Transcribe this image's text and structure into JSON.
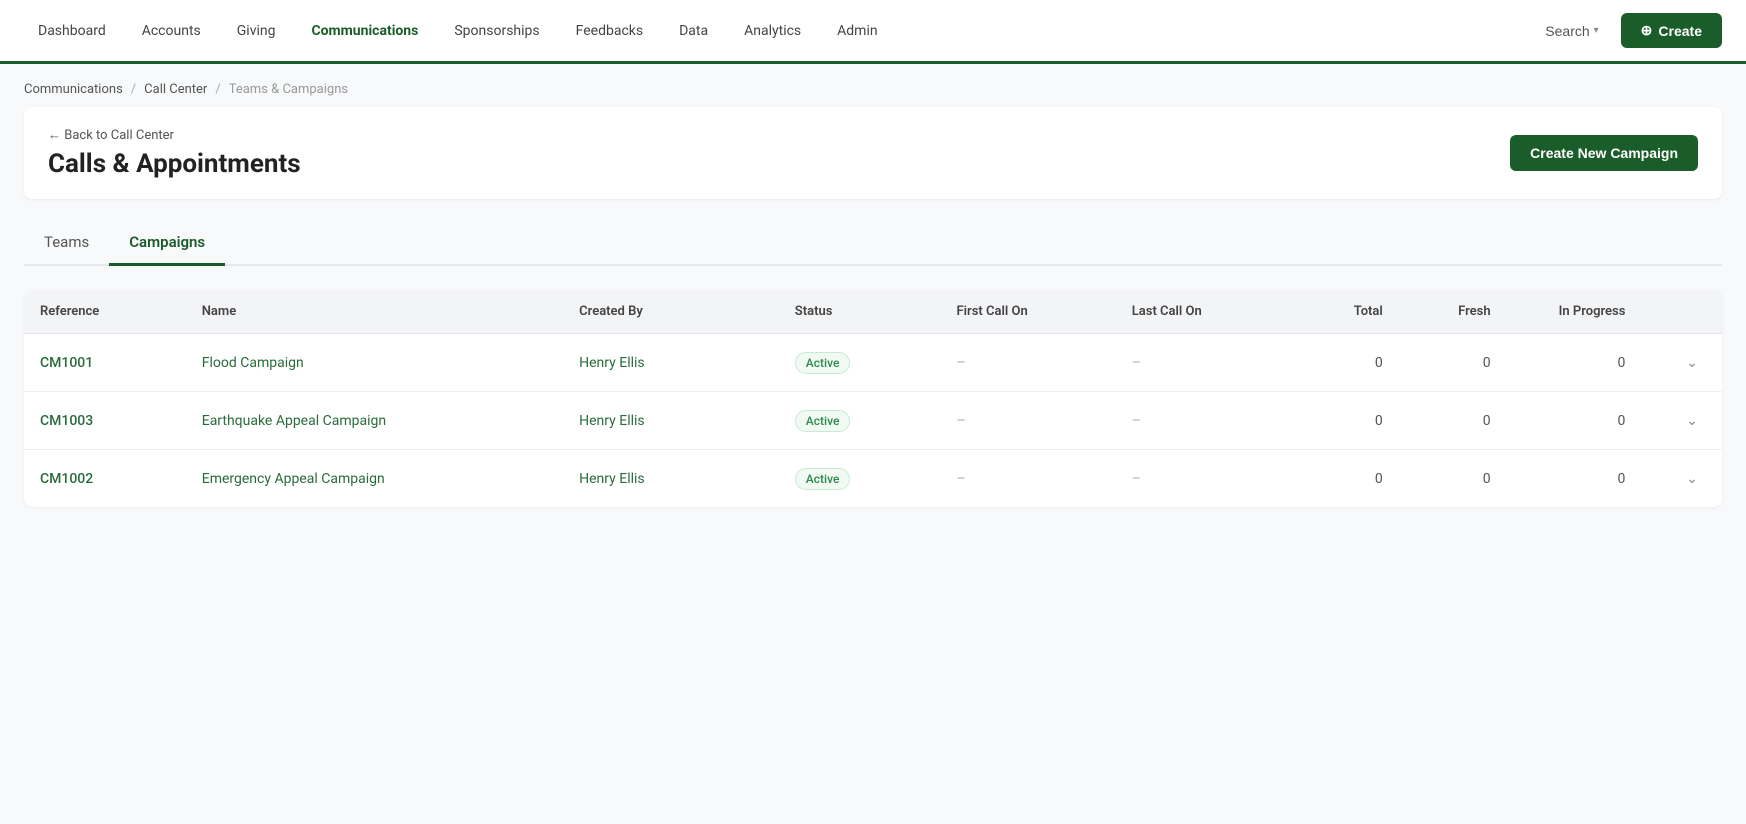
{
  "nav": {
    "items": [
      {
        "id": "dashboard",
        "label": "Dashboard",
        "active": false
      },
      {
        "id": "accounts",
        "label": "Accounts",
        "active": false
      },
      {
        "id": "giving",
        "label": "Giving",
        "active": false
      },
      {
        "id": "communications",
        "label": "Communications",
        "active": true
      },
      {
        "id": "sponsorships",
        "label": "Sponsorships",
        "active": false
      },
      {
        "id": "feedbacks",
        "label": "Feedbacks",
        "active": false
      },
      {
        "id": "data",
        "label": "Data",
        "active": false
      },
      {
        "id": "analytics",
        "label": "Analytics",
        "active": false
      },
      {
        "id": "admin",
        "label": "Admin",
        "active": false
      }
    ],
    "search_label": "Search",
    "create_label": "Create",
    "create_icon": "⊕"
  },
  "breadcrumb": {
    "items": [
      {
        "label": "Communications",
        "link": true
      },
      {
        "label": "Call Center",
        "link": true
      },
      {
        "label": "Teams & Campaigns",
        "link": false
      }
    ],
    "separator": "/"
  },
  "page": {
    "back_label": "← Back to Call Center",
    "title": "Calls & Appointments",
    "create_campaign_label": "Create New Campaign"
  },
  "tabs": [
    {
      "id": "teams",
      "label": "Teams",
      "active": false
    },
    {
      "id": "campaigns",
      "label": "Campaigns",
      "active": true
    }
  ],
  "table": {
    "columns": [
      {
        "id": "reference",
        "label": "Reference"
      },
      {
        "id": "name",
        "label": "Name"
      },
      {
        "id": "created_by",
        "label": "Created By"
      },
      {
        "id": "status",
        "label": "Status"
      },
      {
        "id": "first_call_on",
        "label": "First Call On"
      },
      {
        "id": "last_call_on",
        "label": "Last Call On"
      },
      {
        "id": "total",
        "label": "Total"
      },
      {
        "id": "fresh",
        "label": "Fresh"
      },
      {
        "id": "in_progress",
        "label": "In Progress"
      }
    ],
    "rows": [
      {
        "reference": "CM1001",
        "name": "Flood Campaign",
        "created_by": "Henry Ellis",
        "status": "Active",
        "first_call_on": "–",
        "last_call_on": "–",
        "total": "0",
        "fresh": "0",
        "in_progress": "0"
      },
      {
        "reference": "CM1003",
        "name": "Earthquake Appeal Campaign",
        "created_by": "Henry Ellis",
        "status": "Active",
        "first_call_on": "–",
        "last_call_on": "–",
        "total": "0",
        "fresh": "0",
        "in_progress": "0"
      },
      {
        "reference": "CM1002",
        "name": "Emergency Appeal Campaign",
        "created_by": "Henry Ellis",
        "status": "Active",
        "first_call_on": "–",
        "last_call_on": "–",
        "total": "0",
        "fresh": "0",
        "in_progress": "0"
      }
    ]
  },
  "colors": {
    "brand_dark": "#1a5c2a",
    "active_badge_bg": "#f0faf3",
    "active_badge_text": "#2a8a4a",
    "link_color": "#2a6b3c"
  }
}
